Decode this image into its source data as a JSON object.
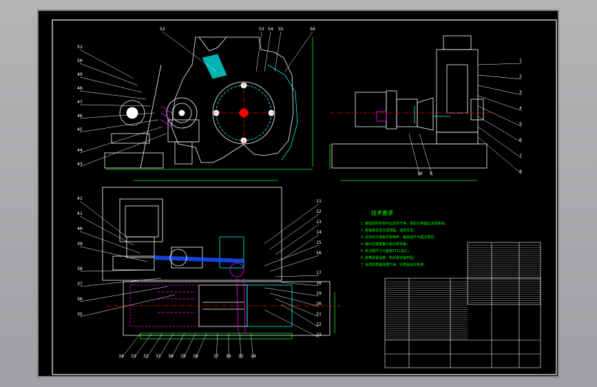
{
  "colors": {
    "background": "#a8a9ab",
    "sheet": "#000000",
    "lines": "#ffffff",
    "dimension": "#00ff00",
    "center": "#ff3b3b",
    "hatch": "#ff00ff",
    "accent": "#00ffff",
    "belt": "#1a4dff",
    "frame": "#ffff00"
  },
  "drawing": {
    "top_labels": [
      "52",
      "53",
      "54",
      "55",
      "56"
    ],
    "left_upper_labels": [
      "51",
      "50",
      "49",
      "48",
      "47",
      "46",
      "45",
      "44",
      "43"
    ],
    "side_view_labels": [
      "1",
      "2",
      "3",
      "4",
      "5",
      "6",
      "7",
      "8",
      "9",
      "10"
    ],
    "plan_right_labels": [
      "11",
      "12",
      "13",
      "14",
      "15",
      "16",
      "17",
      "18",
      "19",
      "20",
      "21",
      "22",
      "23"
    ],
    "plan_left_labels": [
      "42",
      "41",
      "40",
      "39",
      "38",
      "37",
      "36",
      "35"
    ],
    "plan_bottom_labels": [
      "34",
      "33",
      "32",
      "31",
      "30",
      "29",
      "28",
      "27",
      "26",
      "25",
      "24"
    ],
    "notes_title": "技术要求",
    "notes": [
      "1.装配前所有零件应清洗干净，各配合表面应涂润滑油;",
      "2.各轴承处加注润滑脂，运转灵活;",
      "3.试车时不得有异常响声，轴承温升不超过规定;",
      "4.锤片应按重量分组对称安装;",
      "5.未注明尺寸公差按IT12加工;",
      "6.皮带张紧适度，防护罩安装牢固;",
      "7.涂漆前表面清理干净，外表面涂灰色漆。"
    ]
  }
}
